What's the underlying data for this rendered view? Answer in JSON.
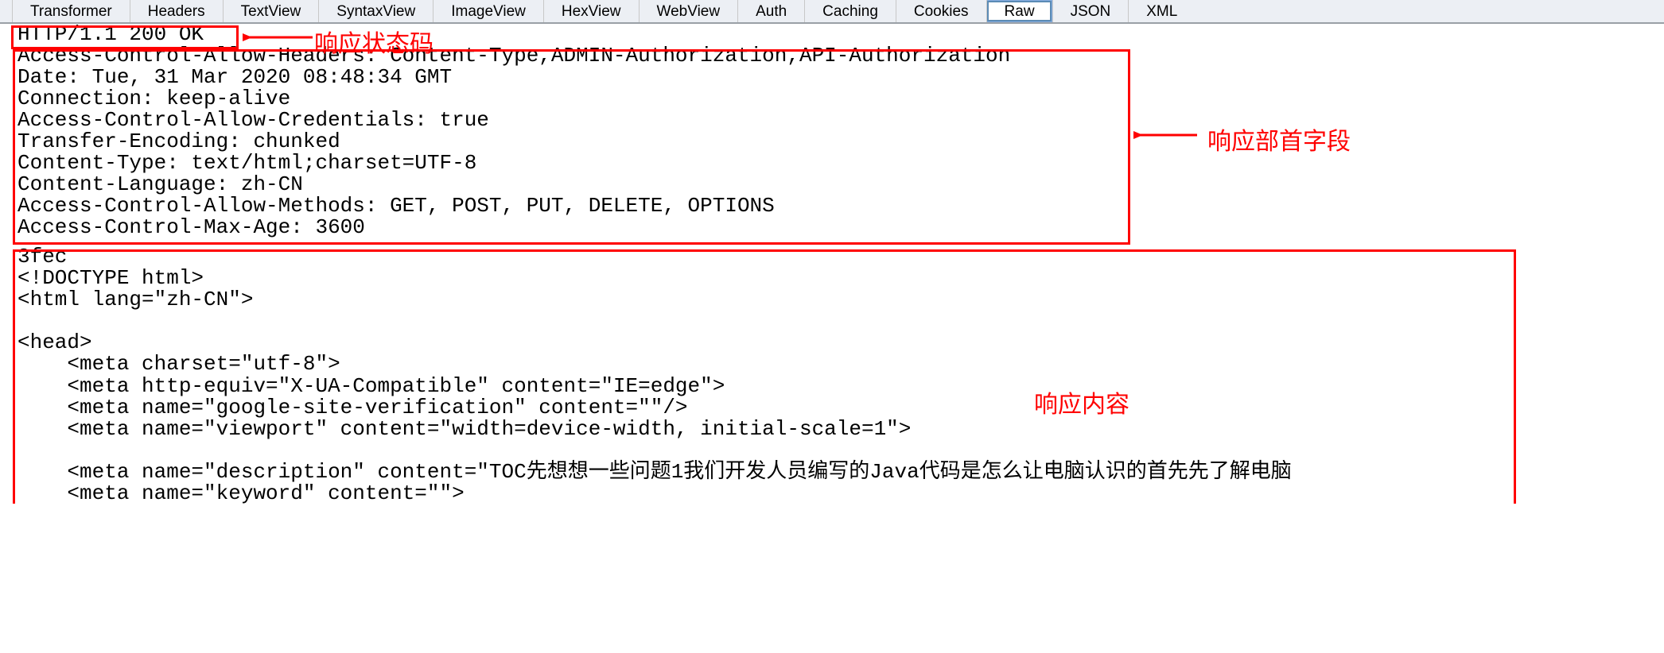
{
  "tabs": [
    {
      "label": "Transformer",
      "active": false
    },
    {
      "label": "Headers",
      "active": false
    },
    {
      "label": "TextView",
      "active": false
    },
    {
      "label": "SyntaxView",
      "active": false
    },
    {
      "label": "ImageView",
      "active": false
    },
    {
      "label": "HexView",
      "active": false
    },
    {
      "label": "WebView",
      "active": false
    },
    {
      "label": "Auth",
      "active": false
    },
    {
      "label": "Caching",
      "active": false
    },
    {
      "label": "Cookies",
      "active": false
    },
    {
      "label": "Raw",
      "active": true
    },
    {
      "label": "JSON",
      "active": false
    },
    {
      "label": "XML",
      "active": false
    }
  ],
  "status_line": "HTTP/1.1 200 OK",
  "headers_block": "Access-Control-Allow-Headers: Content-Type,ADMIN-Authorization,API-Authorization\nDate: Tue, 31 Mar 2020 08:48:34 GMT\nConnection: keep-alive\nAccess-Control-Allow-Credentials: true\nTransfer-Encoding: chunked\nContent-Type: text/html;charset=UTF-8\nContent-Language: zh-CN\nAccess-Control-Allow-Methods: GET, POST, PUT, DELETE, OPTIONS\nAccess-Control-Max-Age: 3600",
  "body_block": "3fec\n<!DOCTYPE html>\n<html lang=\"zh-CN\">\n\n<head>\n    <meta charset=\"utf-8\">\n    <meta http-equiv=\"X-UA-Compatible\" content=\"IE=edge\">\n    <meta name=\"google-site-verification\" content=\"\"/>\n    <meta name=\"viewport\" content=\"width=device-width, initial-scale=1\">\n\n    <meta name=\"description\" content=\"TOC先想想一些问题1我们开发人员编写的Java代码是怎么让电脑认识的首先先了解电脑\n    <meta name=\"keyword\" content=\"\">",
  "annotations": {
    "status_label": "响应状态码",
    "headers_label": "响应部首字段",
    "body_label": "响应内容"
  }
}
